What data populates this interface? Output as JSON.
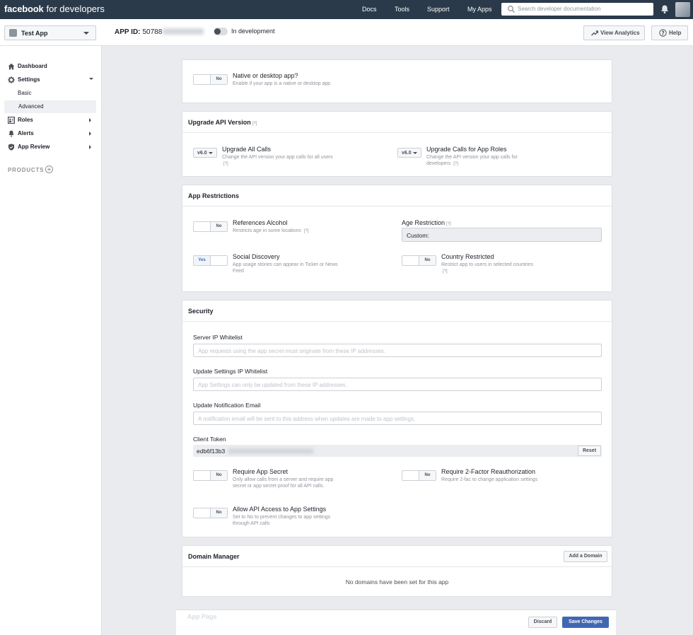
{
  "topbar": {
    "brand_bold": "facebook",
    "brand_rest": "for developers",
    "nav": [
      "Docs",
      "Tools",
      "Support",
      "My Apps"
    ],
    "search_placeholder": "Search developer documentation"
  },
  "appbar": {
    "app_name": "Test App",
    "app_id_label": "APP ID:",
    "app_id_value": "50788",
    "dev_status": "In development",
    "view_analytics": "View Analytics",
    "help": "Help"
  },
  "sidebar": {
    "items": [
      {
        "label": "Dashboard"
      },
      {
        "label": "Settings"
      },
      {
        "label": "Basic"
      },
      {
        "label": "Advanced"
      },
      {
        "label": "Roles"
      },
      {
        "label": "Alerts"
      },
      {
        "label": "App Review"
      }
    ],
    "products": "PRODUCTS"
  },
  "native": {
    "toggle": "No",
    "title": "Native or desktop app?",
    "desc": "Enable if your app is a native or desktop app"
  },
  "api": {
    "title": "Upgrade API Version",
    "help": "[?]",
    "all_version": "v6.0",
    "all_title": "Upgrade All Calls",
    "all_desc": "Change the API version your app calls for all users",
    "roles_version": "v6.0",
    "roles_title": "Upgrade Calls for App Roles",
    "roles_desc": "Change the API version your app calls for developers"
  },
  "restrictions": {
    "title": "App Restrictions",
    "alcohol_toggle": "No",
    "alcohol_title": "References Alcohol",
    "alcohol_desc": "Restricts age in some locations",
    "age_title": "Age Restriction",
    "age_value": "Custom:",
    "social_toggle": "Yes",
    "social_title": "Social Discovery",
    "social_desc": "App usage stories can appear in Ticker or News Feed",
    "country_toggle": "No",
    "country_title": "Country Restricted",
    "country_desc": "Restrict app to users in selected countries"
  },
  "security": {
    "title": "Security",
    "server_ip_label": "Server IP Whitelist",
    "server_ip_placeholder": "App requests using the app secret must originate from these IP addresses.",
    "settings_ip_label": "Update Settings IP Whitelist",
    "settings_ip_placeholder": "App Settings can only be updated from these IP addresses.",
    "email_label": "Update Notification Email",
    "email_placeholder": "A notification email will be sent to this address when updates are made to app settings.",
    "token_label": "Client Token",
    "token_value": "edb6f13b3",
    "reset": "Reset",
    "secret_toggle": "No",
    "secret_title": "Require App Secret",
    "secret_desc": "Only allow calls from a server and require app secret or app secret proof for all API calls.",
    "twofa_toggle": "No",
    "twofa_title": "Require 2-Factor Reauthorization",
    "twofa_desc": "Require 2-fac to change application settings",
    "api_access_toggle": "No",
    "api_access_title": "Allow API Access to App Settings",
    "api_access_desc": "Set to No to prevent changes to app settings through API calls"
  },
  "domain": {
    "title": "Domain Manager",
    "add": "Add a Domain",
    "empty": "No domains have been set for this app"
  },
  "footer": {
    "app_page": "App Page",
    "discard": "Discard",
    "save": "Save Changes"
  },
  "colors": {
    "topbar": "#2b3a4a",
    "primary": "#4267b2",
    "background": "#e9ebee"
  }
}
